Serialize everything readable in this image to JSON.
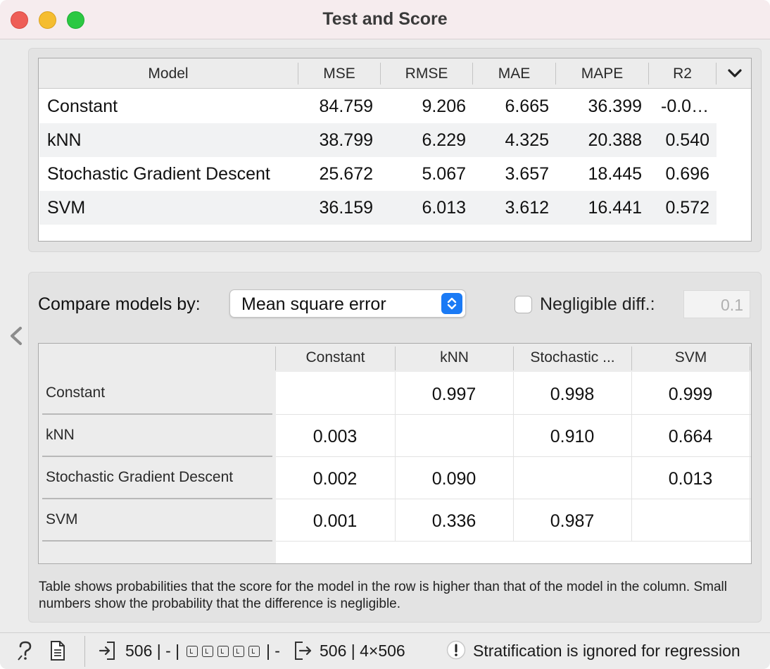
{
  "window": {
    "title": "Test and Score"
  },
  "scores": {
    "columns": [
      "Model",
      "MSE",
      "RMSE",
      "MAE",
      "MAPE",
      "R2"
    ],
    "rows": [
      {
        "model": "Constant",
        "mse": "84.759",
        "rmse": "9.206",
        "mae": "6.665",
        "mape": "36.399",
        "r2": "-0.0…"
      },
      {
        "model": "kNN",
        "mse": "38.799",
        "rmse": "6.229",
        "mae": "4.325",
        "mape": "20.388",
        "r2": "0.540"
      },
      {
        "model": "Stochastic Gradient Descent",
        "mse": "25.672",
        "rmse": "5.067",
        "mae": "3.657",
        "mape": "18.445",
        "r2": "0.696"
      },
      {
        "model": "SVM",
        "mse": "36.159",
        "rmse": "6.013",
        "mae": "3.612",
        "mape": "16.441",
        "r2": "0.572"
      }
    ]
  },
  "compare": {
    "label": "Compare models by:",
    "selected": "Mean square error",
    "negligible_label": "Negligible diff.:",
    "negligible_value": "0.1",
    "negligible_checked": false
  },
  "matrix": {
    "columns": [
      "Constant",
      "kNN",
      "Stochastic ...",
      "SVM"
    ],
    "rows": [
      {
        "label": "Constant",
        "values": [
          "",
          "0.997",
          "0.998",
          "0.999"
        ]
      },
      {
        "label": "kNN",
        "values": [
          "0.003",
          "",
          "0.910",
          "0.664"
        ]
      },
      {
        "label": "Stochastic Gradient Descent",
        "values": [
          "0.002",
          "0.090",
          "",
          "0.013"
        ]
      },
      {
        "label": "SVM",
        "values": [
          "0.001",
          "0.336",
          "0.987",
          ""
        ]
      }
    ]
  },
  "note": "Table shows probabilities that the score for the model in the row is higher than that of the model in the column. Small numbers show the probability that the difference is negligible.",
  "statusbar": {
    "input_prefix": "506 | - |",
    "input_suffix": "| -",
    "output": "506 | 4×506",
    "warning": "Stratification is ignored for regression"
  },
  "icons": {
    "help": "help-icon",
    "report": "report-icon",
    "input": "input-arrow-icon",
    "output": "output-arrow-icon",
    "warning": "warning-icon",
    "collapse": "chevron-left-icon",
    "columns_menu": "chevron-down-icon",
    "select": "updown-chevron-icon"
  }
}
